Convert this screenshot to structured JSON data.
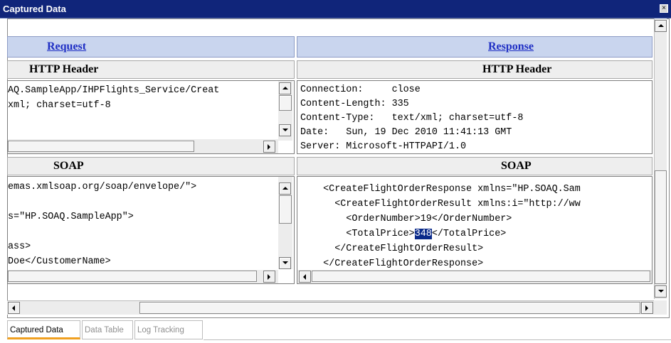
{
  "window": {
    "title": "Captured Data",
    "close_glyph": "×"
  },
  "columns": {
    "request_label": "Request",
    "response_label": "Response"
  },
  "sections": {
    "http_header": "HTTP Header",
    "soap": "SOAP"
  },
  "request": {
    "http_lines": [
      "AQ.SampleApp/IHPFlights_Service/Creat",
      "xml; charset=utf-8"
    ],
    "soap_lines": [
      "emas.xmlsoap.org/soap/envelope/\">",
      "",
      "s=\"HP.SOAQ.SampleApp\">",
      "",
      "ass>",
      "Doe</CustomerName>"
    ]
  },
  "response": {
    "http_lines": [
      "Connection:     close",
      "Content-Length: 335",
      "Content-Type:   text/xml; charset=utf-8",
      "Date:   Sun, 19 Dec 2010 11:41:13 GMT",
      "Server: Microsoft-HTTPAPI/1.0"
    ],
    "soap_lines": [
      "    <CreateFlightOrderResponse xmlns=\"HP.SOAQ.Sam",
      "      <CreateFlightOrderResult xmlns:i=\"http://ww",
      "        <OrderNumber>19</OrderNumber>",
      "        <TotalPrice>",
      "      </CreateFlightOrderResult>",
      "    </CreateFlightOrderResponse>"
    ],
    "total_price_value": "348",
    "total_price_close": "</TotalPrice>"
  },
  "tabs": [
    {
      "label": "Captured Data",
      "active": true
    },
    {
      "label": "Data Table",
      "active": false
    },
    {
      "label": "Log Tracking",
      "active": false
    }
  ]
}
